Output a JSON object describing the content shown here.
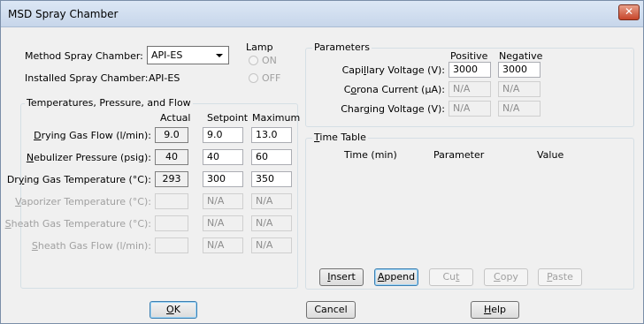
{
  "window": {
    "title": "MSD Spray Chamber",
    "close_glyph": "✕"
  },
  "chamber": {
    "method_label": "Method Spray Chamber:",
    "method_value": "API-ES",
    "installed_label": "Installed Spray Chamber:",
    "installed_value": "API-ES"
  },
  "lamp": {
    "title": "Lamp",
    "on": "ON",
    "off": "OFF"
  },
  "tpf": {
    "title": "Temperatures, Pressure, and Flow",
    "headers": {
      "actual": "Actual",
      "setpoint": "Setpoint",
      "maximum": "Maximum"
    },
    "rows": [
      {
        "pre": "",
        "u": "D",
        "post": "rying Gas Flow (l/min):",
        "actual": "9.0",
        "setpoint": "9.0",
        "maximum": "13.0",
        "enabled": true
      },
      {
        "pre": "",
        "u": "N",
        "post": "ebulizer Pressure (psig):",
        "actual": "40",
        "setpoint": "40",
        "maximum": "60",
        "enabled": true
      },
      {
        "pre": "Dr",
        "u": "y",
        "post": "ing Gas Temperature (°C):",
        "actual": "293",
        "setpoint": "300",
        "maximum": "350",
        "enabled": true
      },
      {
        "pre": "",
        "u": "V",
        "post": "aporizer Temperature (°C):",
        "actual": "",
        "setpoint": "N/A",
        "maximum": "N/A",
        "enabled": false
      },
      {
        "pre": "",
        "u": "S",
        "post": "heath Gas  Temperature (°C):",
        "actual": "",
        "setpoint": "N/A",
        "maximum": "N/A",
        "enabled": false
      },
      {
        "pre": "",
        "u": "S",
        "post": "heath Gas Flow (l/min):",
        "actual": "",
        "setpoint": "N/A",
        "maximum": "N/A",
        "enabled": false
      }
    ]
  },
  "params": {
    "title": "Parameters",
    "headers": {
      "positive": "Positive",
      "negative": "Negative"
    },
    "rows": [
      {
        "pre": "Capi",
        "u": "l",
        "post": "lary Voltage (V):",
        "positive": "3000",
        "negative": "3000",
        "enabled": true
      },
      {
        "pre": "C",
        "u": "o",
        "post": "rona Current (µA):",
        "positive": "N/A",
        "negative": "N/A",
        "enabled": false
      },
      {
        "pre": "Char",
        "u": "g",
        "post": "ing Voltage (V):",
        "positive": "N/A",
        "negative": "N/A",
        "enabled": false
      }
    ]
  },
  "timetable": {
    "title_u": "T",
    "title_rest": "ime Table",
    "columns": [
      "Time (min)",
      "Parameter",
      "Value"
    ],
    "buttons": [
      {
        "u": "I",
        "rest": "nsert",
        "pre": "",
        "enabled": true
      },
      {
        "u": "A",
        "rest": "ppend",
        "pre": "",
        "enabled": true
      },
      {
        "pre": "Cu",
        "u": "t",
        "rest": "",
        "enabled": false
      },
      {
        "u": "C",
        "rest": "opy",
        "pre": "",
        "enabled": false
      },
      {
        "u": "P",
        "rest": "aste",
        "pre": "",
        "enabled": false
      }
    ]
  },
  "footer": {
    "ok_u": "O",
    "ok_rest": "K",
    "cancel": "Cancel",
    "help_u": "H",
    "help_rest": "elp"
  }
}
